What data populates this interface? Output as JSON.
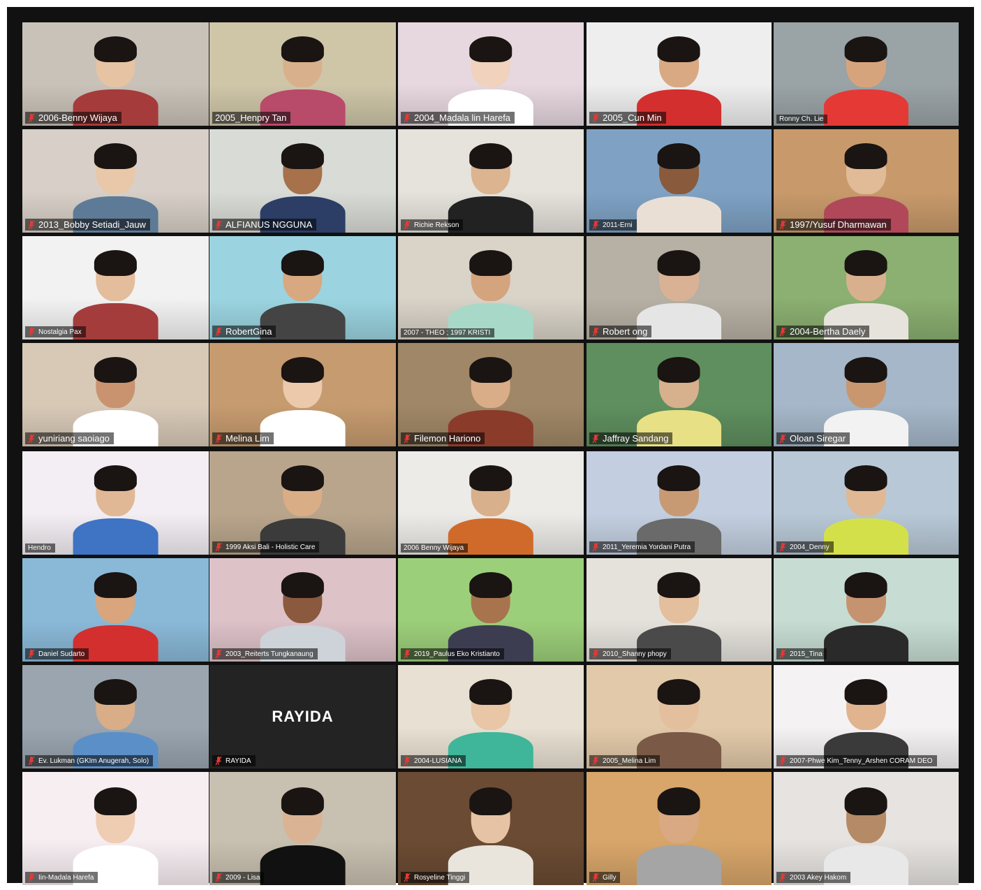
{
  "app": "Zoom gallery view",
  "colors": {
    "muted_icon": "#e53935",
    "active_speaker": "#d4dc6a",
    "tile_bg": "#2a2a2a"
  },
  "participants": [
    {
      "name": "2006-Benny Wijaya",
      "muted": true,
      "bg": "#c9c2b8",
      "skin": "#e6c3a3",
      "shirt": "#a63b3b"
    },
    {
      "name": "2005_Henpry Tan",
      "muted": false,
      "bg": "#cfc6a8",
      "skin": "#d9b08c",
      "shirt": "#b84a6a",
      "speaker": true
    },
    {
      "name": "2004_Madala lin Harefa",
      "muted": true,
      "bg": "#e7d7df",
      "skin": "#f0d2bd",
      "shirt": "#ffffff"
    },
    {
      "name": "2005_Cun Min",
      "muted": true,
      "bg": "#eeeeee",
      "skin": "#d8a983",
      "shirt": "#d32f2f"
    },
    {
      "name": "Ronny Ch. Lie",
      "muted": false,
      "bg": "#9aa3a6",
      "skin": "#d6a47c",
      "shirt": "#e53935",
      "small": true
    },
    {
      "name": "2013_Bobby Setiadi_Jauw",
      "muted": true,
      "bg": "#d8d0c8",
      "skin": "#e8c8a9",
      "shirt": "#5d7b96"
    },
    {
      "name": "ALFIANUS NGGUNA",
      "muted": true,
      "bg": "#d9dbd6",
      "skin": "#a6714b",
      "shirt": "#2c3e66"
    },
    {
      "name": "Richie Rekson",
      "muted": true,
      "bg": "#e6e2dc",
      "skin": "#dcb48f",
      "shirt": "#222222",
      "small": true
    },
    {
      "name": "2011-Erni",
      "muted": true,
      "bg": "#7fa2c4",
      "skin": "#8a5a3c",
      "shirt": "#e9dfd4",
      "small": true
    },
    {
      "name": "1997/Yusuf Dharmawan",
      "muted": true,
      "bg": "#c89a6b",
      "skin": "#e1bb98",
      "shirt": "#b0485a"
    },
    {
      "name": "Nostalgia Pax",
      "muted": true,
      "bg": "#f2f2f2",
      "skin": "#e4bd9c",
      "shirt": "#a43c3c",
      "small": true
    },
    {
      "name": "RobertGina",
      "muted": true,
      "bg": "#9bd4e0",
      "skin": "#d8a880",
      "shirt": "#444444"
    },
    {
      "name": "2007 - THEO ; 1997 KRISTI",
      "muted": false,
      "bg": "#d9d3c8",
      "skin": "#d3a47e",
      "shirt": "#a8d8c8",
      "small": true
    },
    {
      "name": "Robert ong",
      "muted": true,
      "bg": "#b7b0a4",
      "skin": "#d9b295",
      "shirt": "#e5e5e5"
    },
    {
      "name": "2004-Bertha Daely",
      "muted": true,
      "bg": "#8bb071",
      "skin": "#d9b08e",
      "shirt": "#e6e3dc"
    },
    {
      "name": "yuniriang saoiago",
      "muted": true,
      "bg": "#d8c9b7",
      "skin": "#c99370",
      "shirt": "#ffffff"
    },
    {
      "name": "Melina Lim",
      "muted": true,
      "bg": "#c69b6f",
      "skin": "#ecc9ab",
      "shirt": "#ffffff"
    },
    {
      "name": "Filemon Hariono",
      "muted": true,
      "bg": "#a08767",
      "skin": "#d8ad88",
      "shirt": "#8b3b2a"
    },
    {
      "name": "Jaffray Sandang",
      "muted": true,
      "bg": "#5f8f5f",
      "skin": "#d7b08d",
      "shirt": "#e8e085"
    },
    {
      "name": "Oloan Siregar",
      "muted": true,
      "bg": "#a5b7c9",
      "skin": "#c9976f",
      "shirt": "#f2f2f2"
    },
    {
      "name": "Hendro",
      "muted": false,
      "bg": "#f3eef3",
      "skin": "#e0b896",
      "shirt": "#3f73c4",
      "small": true
    },
    {
      "name": "1999 Aksi Bali - Holistic Care",
      "muted": true,
      "bg": "#b9a58c",
      "skin": "#d9ad86",
      "shirt": "#3b3b3b",
      "small": true,
      "speaker": true
    },
    {
      "name": "2006 Benny Wijaya",
      "muted": false,
      "bg": "#ecebe8",
      "skin": "#d8b08c",
      "shirt": "#d06a2a",
      "small": true
    },
    {
      "name": "2011_Yeremia Yordani Putra",
      "muted": true,
      "bg": "#c3cfe0",
      "skin": "#c89a74",
      "shirt": "#6a6a6a",
      "small": true
    },
    {
      "name": "2004_Denny",
      "muted": true,
      "bg": "#b8c8d6",
      "skin": "#e0b894",
      "shirt": "#d4e04a",
      "small": true
    },
    {
      "name": "Daniel Sudarto",
      "muted": true,
      "bg": "#8ab9d8",
      "skin": "#d8a57c",
      "shirt": "#d32f2f",
      "small": true
    },
    {
      "name": "2003_Reiterts Tungkanaung",
      "muted": true,
      "bg": "#ddc2c8",
      "skin": "#8b5a3e",
      "shirt": "#cdd3d8",
      "small": true
    },
    {
      "name": "2019_Paulus Eko Kristianto",
      "muted": true,
      "bg": "#9ccf7a",
      "skin": "#a8744e",
      "shirt": "#3d3d52",
      "small": true
    },
    {
      "name": "2010_Shanny phopy",
      "muted": true,
      "bg": "#e5e2dc",
      "skin": "#e3bf9e",
      "shirt": "#4a4a4a",
      "small": true
    },
    {
      "name": "2015_Tina",
      "muted": true,
      "bg": "#c7ddd3",
      "skin": "#c69371",
      "shirt": "#2a2a2a",
      "small": true
    },
    {
      "name": "Ev. Lukman (GKIm Anugerah, Solo)",
      "muted": true,
      "bg": "#9aa5b0",
      "skin": "#d8ad88",
      "shirt": "#5b8fc7",
      "small": true
    },
    {
      "name": "RAYIDA",
      "muted": true,
      "noVideo": true,
      "display": "RAYIDA",
      "small": true
    },
    {
      "name": "2004-LUSIANA",
      "muted": true,
      "bg": "#e8e0d2",
      "skin": "#e8c6a6",
      "shirt": "#3fb59a",
      "small": true
    },
    {
      "name": "2005_Melina Lim",
      "muted": true,
      "bg": "#e2c9a9",
      "skin": "#e3bf9e",
      "shirt": "#7a5a46",
      "small": true
    },
    {
      "name": "2007-Phwe Kim_Tenny_Arshen CORAM DEO",
      "muted": true,
      "bg": "#f5f2f4",
      "skin": "#e0b48f",
      "shirt": "#3a3a3a",
      "small": true
    },
    {
      "name": "Iin-Madala Harefa",
      "muted": true,
      "bg": "#f7eef2",
      "skin": "#efcdb2",
      "shirt": "#ffffff",
      "small": true
    },
    {
      "name": "2009 - Lisa",
      "muted": true,
      "bg": "#c8c0b0",
      "skin": "#d9b393",
      "shirt": "#111111",
      "small": true,
      "speaker": true
    },
    {
      "name": "Rosyeline Tinggi",
      "muted": true,
      "bg": "#6b4b33",
      "skin": "#e6c3a4",
      "shirt": "#e9e4dc",
      "small": true
    },
    {
      "name": "Gilly",
      "muted": true,
      "bg": "#d8a66a",
      "skin": "#d8a982",
      "shirt": "#a5a5a5",
      "small": true
    },
    {
      "name": "2003 Akey Hakom",
      "muted": true,
      "bg": "#e6e3e0",
      "skin": "#b58a66",
      "shirt": "#e8e8e8",
      "small": true
    }
  ]
}
